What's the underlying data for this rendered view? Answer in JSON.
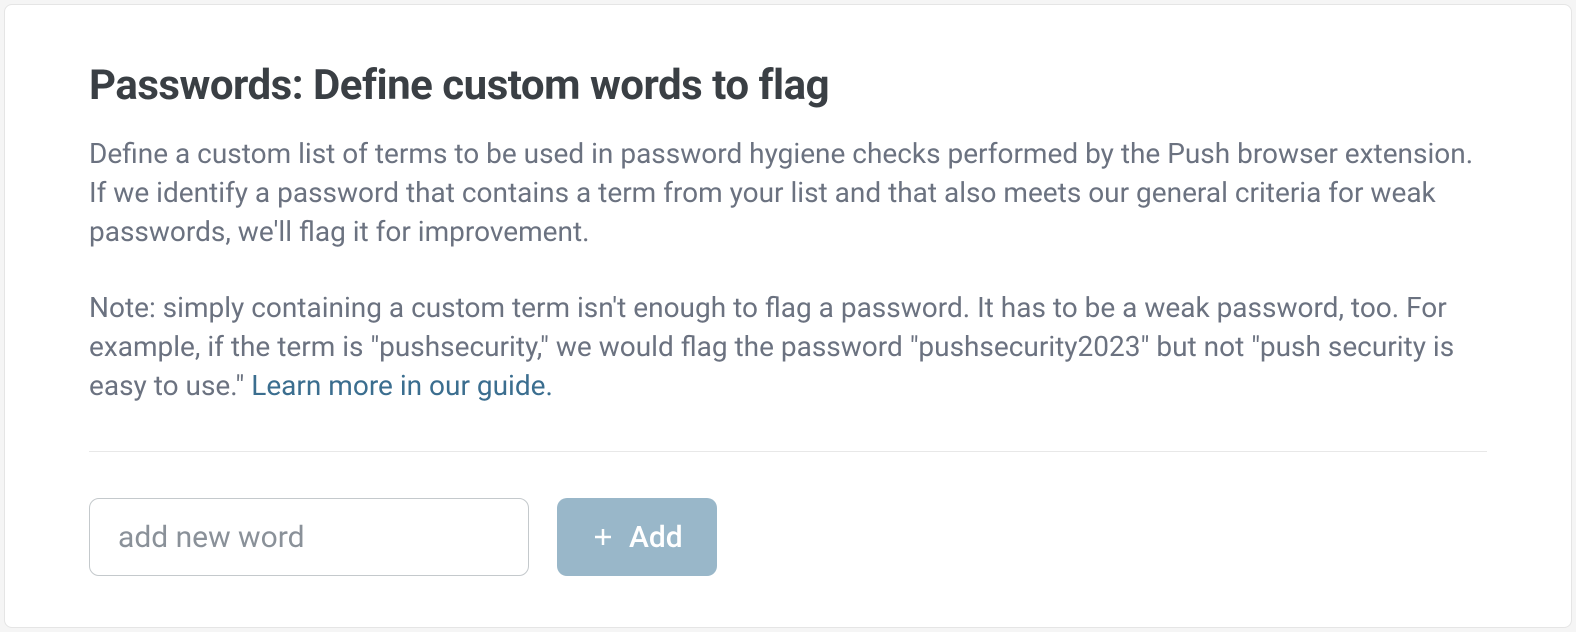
{
  "header": {
    "title": "Passwords: Define custom words to flag"
  },
  "body": {
    "description": "Define a custom list of terms to be used in password hygiene checks performed by the Push browser extension. If we identify a password that contains a term from your list and that also meets our general criteria for weak passwords, we'll flag it for improvement.",
    "note": "Note: simply containing a custom term isn't enough to flag a password. It has to be a weak password, too. For example, if the term is \"pushsecurity,\" we would flag the password \"pushsecurity2023\" but not \"push security is easy to use.\" ",
    "learn_more_label": "Learn more in our guide."
  },
  "form": {
    "input_placeholder": "add new word",
    "input_value": "",
    "add_button_label": "Add"
  },
  "colors": {
    "accent_button": "#99b7c9",
    "link": "#3b6e8f",
    "text_heading": "#3a3f44",
    "text_body": "#6b7280"
  }
}
